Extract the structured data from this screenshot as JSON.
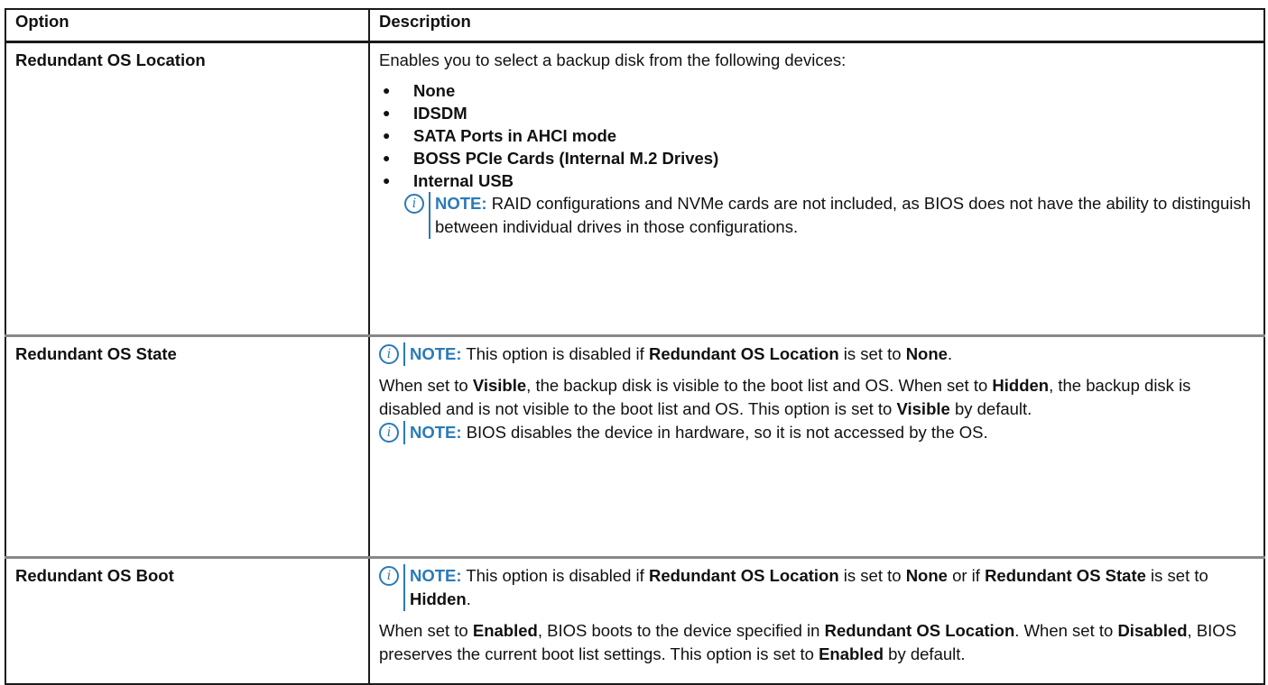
{
  "table": {
    "headers": {
      "option": "Option",
      "description": "Description"
    },
    "rows": [
      {
        "option": "Redundant OS Location",
        "intro": "Enables you to select a backup disk from the following devices:",
        "bullet_glyph": "●",
        "devices": [
          "None",
          "IDSDM",
          "SATA Ports in AHCI mode",
          "BOSS PCIe Cards (Internal M.2 Drives)",
          "Internal USB"
        ],
        "note": {
          "label": "NOTE:",
          "text": " RAID configurations and NVMe cards are not included, as BIOS does not have the ability to distinguish between individual drives in those configurations."
        }
      },
      {
        "option": "Redundant OS State",
        "note1": {
          "label": "NOTE:",
          "t1": " This option is disabled if ",
          "b1": "Redundant OS Location",
          "t2": " is set to ",
          "b2": "None",
          "t3": "."
        },
        "para": {
          "t1": "When set to ",
          "b1": "Visible",
          "t2": ", the backup disk is visible to the boot list and OS. When set to ",
          "b2": "Hidden",
          "t3": ", the backup disk is disabled and is not visible to the boot list and OS. This option is set to ",
          "b3": "Visible",
          "t4": " by default."
        },
        "note2": {
          "label": "NOTE:",
          "text": " BIOS disables the device in hardware, so it is not accessed by the OS."
        }
      },
      {
        "option": "Redundant OS Boot",
        "note1": {
          "label": "NOTE:",
          "t1": " This option is disabled if ",
          "b1": "Redundant OS Location",
          "t2": " is set to ",
          "b2": "None",
          "t3": " or if ",
          "b3": "Redundant OS State",
          "t4": " is set to ",
          "b4": "Hidden",
          "t5": "."
        },
        "para": {
          "t1": "When set to ",
          "b1": "Enabled",
          "t2": ", BIOS boots to the device specified in ",
          "b2": "Redundant OS Location",
          "t3": ". When set to ",
          "b3": "Disabled",
          "t4": ", BIOS preserves the current boot list settings. This option is set to ",
          "b4": "Enabled",
          "t5": " by default."
        }
      }
    ]
  },
  "icons": {
    "info": "info-icon",
    "info_glyph": "i"
  },
  "colors": {
    "note_accent": "#2a7ab8",
    "border": "#1a1a1a",
    "row_separator": "#888888"
  }
}
